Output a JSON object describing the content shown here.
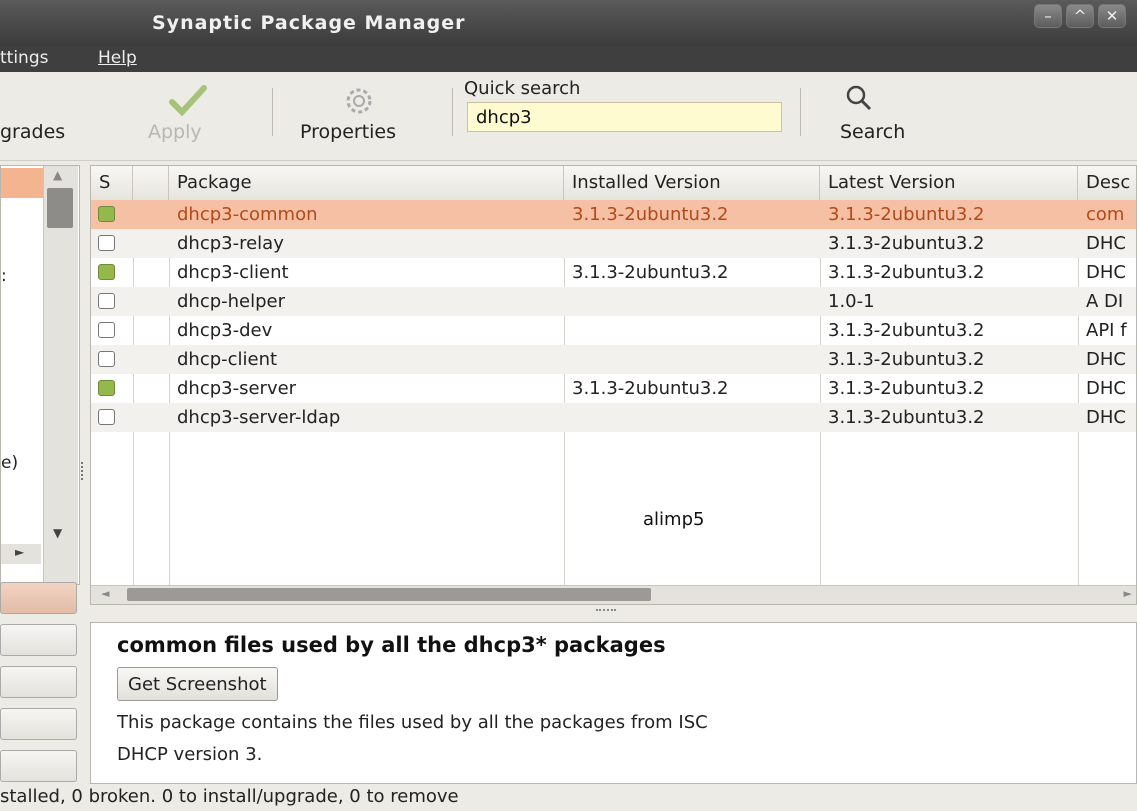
{
  "window": {
    "title": "Synaptic Package Manager",
    "buttons": [
      "–",
      "^",
      "✕"
    ]
  },
  "menu": {
    "items": [
      "ttings",
      "Help"
    ]
  },
  "toolbar": {
    "upgrades_label": "grades",
    "apply_label": "Apply",
    "properties_label": "Properties",
    "quick_search_label": "Quick search",
    "quick_search_value": "dhcp3",
    "search_label": "Search"
  },
  "left": {
    "items": [
      ":",
      "e)"
    ]
  },
  "table": {
    "headers": [
      "S",
      "Package",
      "Installed Version",
      "Latest Version",
      "Desc"
    ],
    "rows": [
      {
        "installed": true,
        "package": "dhcp3-common",
        "installed_version": "3.1.3-2ubuntu3.2",
        "latest_version": "3.1.3-2ubuntu3.2",
        "desc": "com"
      },
      {
        "installed": false,
        "package": "dhcp3-relay",
        "installed_version": "",
        "latest_version": "3.1.3-2ubuntu3.2",
        "desc": "DHC"
      },
      {
        "installed": true,
        "package": "dhcp3-client",
        "installed_version": "3.1.3-2ubuntu3.2",
        "latest_version": "3.1.3-2ubuntu3.2",
        "desc": "DHC"
      },
      {
        "installed": false,
        "package": "dhcp-helper",
        "installed_version": "",
        "latest_version": "1.0-1",
        "desc": "A DI"
      },
      {
        "installed": false,
        "package": "dhcp3-dev",
        "installed_version": "",
        "latest_version": "3.1.3-2ubuntu3.2",
        "desc": "API f"
      },
      {
        "installed": false,
        "package": "dhcp-client",
        "installed_version": "",
        "latest_version": "3.1.3-2ubuntu3.2",
        "desc": "DHC"
      },
      {
        "installed": true,
        "package": "dhcp3-server",
        "installed_version": "3.1.3-2ubuntu3.2",
        "latest_version": "3.1.3-2ubuntu3.2",
        "desc": "DHC"
      },
      {
        "installed": false,
        "package": "dhcp3-server-ldap",
        "installed_version": "",
        "latest_version": "3.1.3-2ubuntu3.2",
        "desc": "DHC"
      }
    ],
    "selected_row": 0,
    "watermark": "alimp5"
  },
  "details": {
    "title": "common files used by all the dhcp3* packages",
    "screenshot_button": "Get Screenshot",
    "description_line1": "This package contains the files used by all the packages from ISC",
    "description_line2": "DHCP version 3."
  },
  "status": {
    "text": "stalled, 0 broken. 0 to install/upgrade, 0 to remove"
  },
  "colors": {
    "selection": "#f6c0a4",
    "installed_marker": "#94b84b",
    "quick_search_bg": "#fffbd0"
  }
}
